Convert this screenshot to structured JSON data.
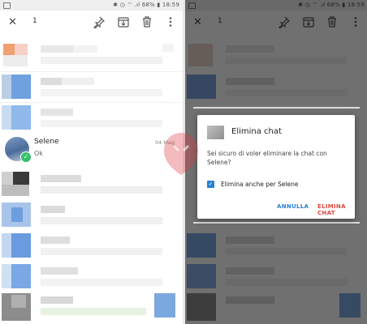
{
  "status": {
    "battery_text": "68%",
    "time": "18:59"
  },
  "toolbar": {
    "count": "1",
    "icons": [
      "close-icon",
      "pin-icon",
      "archive-icon",
      "trash-icon",
      "more-icon"
    ]
  },
  "chat": {
    "name": "Selene",
    "message": "Ok",
    "date": "04 Mag"
  },
  "dialog": {
    "title": "Elimina chat",
    "body": "Sei sicuro di voler eliminare la chat con Selene?",
    "checkbox_label": "Elimina anche per Selene",
    "cancel_label": "ANNULLA",
    "confirm_label": "ELIMINA CHAT"
  },
  "colors": {
    "accent": "#2a7fd1",
    "danger": "#e0453b",
    "check": "#33c06a"
  }
}
